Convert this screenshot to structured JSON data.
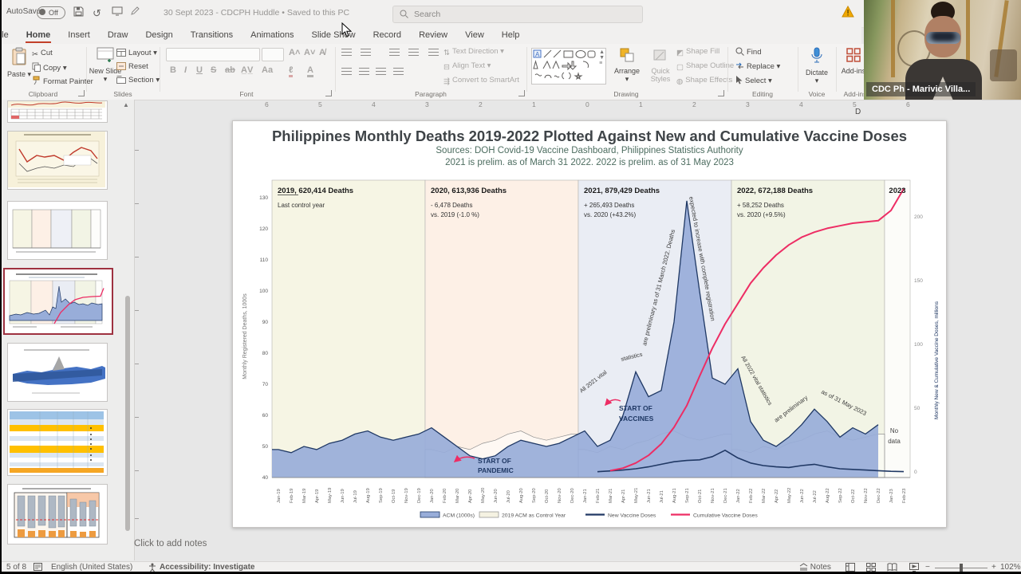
{
  "titlebar": {
    "autosave_label": "AutoSave",
    "autosave_state": "Off",
    "doc_title": "30 Sept 2023 - CDCPH Huddle • Saved to this PC",
    "search_placeholder": "Search"
  },
  "menu": {
    "tabs": [
      "File",
      "Home",
      "Insert",
      "Draw",
      "Design",
      "Transitions",
      "Animations",
      "Slide Show",
      "Record",
      "Review",
      "View",
      "Help"
    ],
    "active": "Home"
  },
  "ribbon": {
    "paste": "Paste",
    "cut": "Cut",
    "copy": "Copy",
    "format_painter": "Format Painter",
    "clipboard_label": "Clipboard",
    "new_slide": "New Slide",
    "layout": "Layout",
    "reset": "Reset",
    "section": "Section",
    "slides_label": "Slides",
    "font_label": "Font",
    "text_direction": "Text Direction",
    "align_text": "Align Text",
    "convert_smartart": "Convert to SmartArt",
    "paragraph_label": "Paragraph",
    "arrange": "Arrange",
    "quick_styles": "Quick Styles",
    "shape_fill": "Shape Fill",
    "shape_outline": "Shape Outline",
    "shape_effects": "Shape Effects",
    "drawing_label": "Drawing",
    "find": "Find",
    "replace": "Replace",
    "select": "Select",
    "editing_label": "Editing",
    "dictate": "Dictate",
    "voice_label": "Voice",
    "addins": "Add-ins",
    "addins_label": "Add-ins",
    "designer_partial": "D"
  },
  "webcam": {
    "name_label": "CDC Ph - Marivic Villa..."
  },
  "ruler": {
    "numbers": [
      "6",
      "5",
      "4",
      "3",
      "2",
      "1",
      "0",
      "1",
      "2",
      "3",
      "4",
      "5",
      "6"
    ]
  },
  "slide": {
    "title": "Philippines Monthly Deaths 2019-2022 Plotted Against New and Cumulative Vaccine Doses",
    "subtitle1": "Sources: DOH Covid-19 Vaccine Dashboard, Philippines Statistics Authority",
    "subtitle2": "2021 is prelim. as of March 31 2022. 2022 is prelim. as of 31 May 2023"
  },
  "notes_hint": "Click to add notes",
  "statusbar": {
    "slide_position": "5 of 8",
    "language": "English (United States)",
    "accessibility": "Accessibility: Investigate",
    "notes_button": "Notes",
    "zoom_level": "102%"
  },
  "chart_data": {
    "type": "area+line",
    "x": [
      "Jan-19",
      "Feb-19",
      "Mar-19",
      "Apr-19",
      "May-19",
      "Jun-19",
      "Jul-19",
      "Aug-19",
      "Sep-19",
      "Oct-19",
      "Nov-19",
      "Dec-19",
      "Jan-20",
      "Feb-20",
      "Mar-20",
      "Apr-20",
      "May-20",
      "Jun-20",
      "Jul-20",
      "Aug-20",
      "Sep-20",
      "Oct-20",
      "Nov-20",
      "Dec-20",
      "Jan-21",
      "Feb-21",
      "Mar-21",
      "Apr-21",
      "May-21",
      "Jun-21",
      "Jul-21",
      "Aug-21",
      "Sep-21",
      "Oct-21",
      "Nov-21",
      "Dec-21",
      "Jan-22",
      "Feb-22",
      "Mar-22",
      "Apr-22",
      "May-22",
      "Jun-22",
      "Jul-22",
      "Aug-22",
      "Sep-22",
      "Oct-22",
      "Nov-22",
      "Dec-22",
      "Jan-23",
      "Feb-23"
    ],
    "series": [
      {
        "name": "ACM (1000s)",
        "axis": "left",
        "type": "area",
        "color": "#98add9",
        "stroke": "#1f3864",
        "values": [
          49,
          48,
          50,
          49,
          51,
          52,
          54,
          55,
          53,
          52,
          53,
          54,
          56,
          53,
          50,
          47,
          46,
          47,
          50,
          52,
          51,
          50,
          51,
          53,
          55,
          50,
          52,
          60,
          74,
          66,
          68,
          90,
          129,
          100,
          72,
          70,
          75,
          58,
          52,
          50,
          53,
          57,
          62,
          58,
          53,
          56,
          54,
          57,
          null,
          null
        ]
      },
      {
        "name": "New Vaccine Doses",
        "axis": "right",
        "type": "line",
        "color": "#203864",
        "values": [
          null,
          null,
          null,
          null,
          null,
          null,
          null,
          null,
          null,
          null,
          null,
          null,
          null,
          null,
          null,
          null,
          null,
          null,
          null,
          null,
          null,
          null,
          null,
          null,
          null,
          0.2,
          0.8,
          1.5,
          2.5,
          4,
          6,
          8,
          9,
          9.5,
          12,
          17,
          11,
          7,
          5,
          4,
          3.5,
          5,
          6,
          4,
          2.5,
          2,
          1.5,
          1,
          0.5,
          0.3
        ]
      },
      {
        "name": "Cumulative Vaccine Doses",
        "axis": "right",
        "type": "line",
        "color": "#ed2d64",
        "values": [
          null,
          null,
          null,
          null,
          null,
          null,
          null,
          null,
          null,
          null,
          null,
          null,
          null,
          null,
          null,
          null,
          null,
          null,
          null,
          null,
          null,
          null,
          null,
          null,
          null,
          null,
          1,
          3,
          7,
          13,
          22,
          35,
          52,
          75,
          97,
          116,
          132,
          148,
          160,
          170,
          178,
          184,
          188,
          191,
          193,
          195,
          196,
          197,
          205,
          222
        ]
      }
    ],
    "left_axis": {
      "title": "Monthly Registered Deaths, 1000s",
      "ticks": [
        40,
        50,
        60,
        70,
        80,
        90,
        100,
        110,
        120,
        130
      ],
      "range": [
        40,
        130
      ]
    },
    "right_axis": {
      "title": "Monthly New & Cumulative Vaccine Doses, millions",
      "ticks": [
        0,
        50,
        100,
        150,
        200
      ],
      "range": [
        0,
        225
      ]
    },
    "panels": [
      {
        "year": "2019",
        "heading": "2019, 620,414  Deaths",
        "sub": [
          "Last control year"
        ],
        "color": "#f6f5e4",
        "months": [
          0,
          12
        ]
      },
      {
        "year": "2020",
        "heading": "2020, 613,936  Deaths",
        "sub": [
          "- 6,478 Deaths",
          "vs. 2019 (-1.0 %)"
        ],
        "color": "#fdf0e6",
        "months": [
          12,
          24
        ]
      },
      {
        "year": "2021",
        "heading": "2021, 879,429 Deaths",
        "sub": [
          "+ 265,493 Deaths",
          "vs. 2020 (+43.2%)"
        ],
        "color": "#eaedf4",
        "months": [
          24,
          36
        ]
      },
      {
        "year": "2022",
        "heading": "2022, 672,188 Deaths",
        "sub": [
          "+ 58,252 Deaths",
          "vs. 2020 (+9.5%)"
        ],
        "color": "#f2f4e5",
        "months": [
          36,
          48
        ]
      },
      {
        "year": "2023",
        "heading": "2023",
        "sub": [],
        "color": "#fcfcf9",
        "months": [
          48,
          50
        ]
      }
    ],
    "legend": [
      {
        "label": "ACM (1000s)",
        "swatch": "area",
        "color": "#98add9",
        "stroke": "#1f3864"
      },
      {
        "label": "2019 ACM as Control Year",
        "swatch": "box",
        "color": "#f5f2e2",
        "stroke": "#999999"
      },
      {
        "label": "New Vaccine Doses",
        "swatch": "line",
        "color": "#203864"
      },
      {
        "label": "Cumulative Vaccine Doses",
        "swatch": "line",
        "color": "#ed2d64"
      }
    ],
    "annotations": [
      {
        "id": "start-pandemic",
        "lines": [
          "START OF",
          "PANDEMIC"
        ]
      },
      {
        "id": "start-vaccines",
        "lines": [
          "START OF",
          "VACCINES"
        ]
      },
      {
        "id": "vital-2021-a",
        "text": "All 2021 vital"
      },
      {
        "id": "vital-2021-b",
        "text": "statistics"
      },
      {
        "id": "vital-2021-c",
        "text": "are preliminary as of 31 March 2022. Deaths"
      },
      {
        "id": "vital-2021-d",
        "text": "expected to increase with complete registration"
      },
      {
        "id": "vital-2022-a",
        "text": "All 2022 vital statistics"
      },
      {
        "id": "vital-2022-b",
        "text": "are preliminary"
      },
      {
        "id": "vital-2022-c",
        "text": "as of 31 May 2023"
      },
      {
        "id": "no-data",
        "lines": [
          "No",
          "data"
        ]
      }
    ],
    "ghost_overlay": "2019 monthly values repeated over 2020-2022 panels"
  }
}
